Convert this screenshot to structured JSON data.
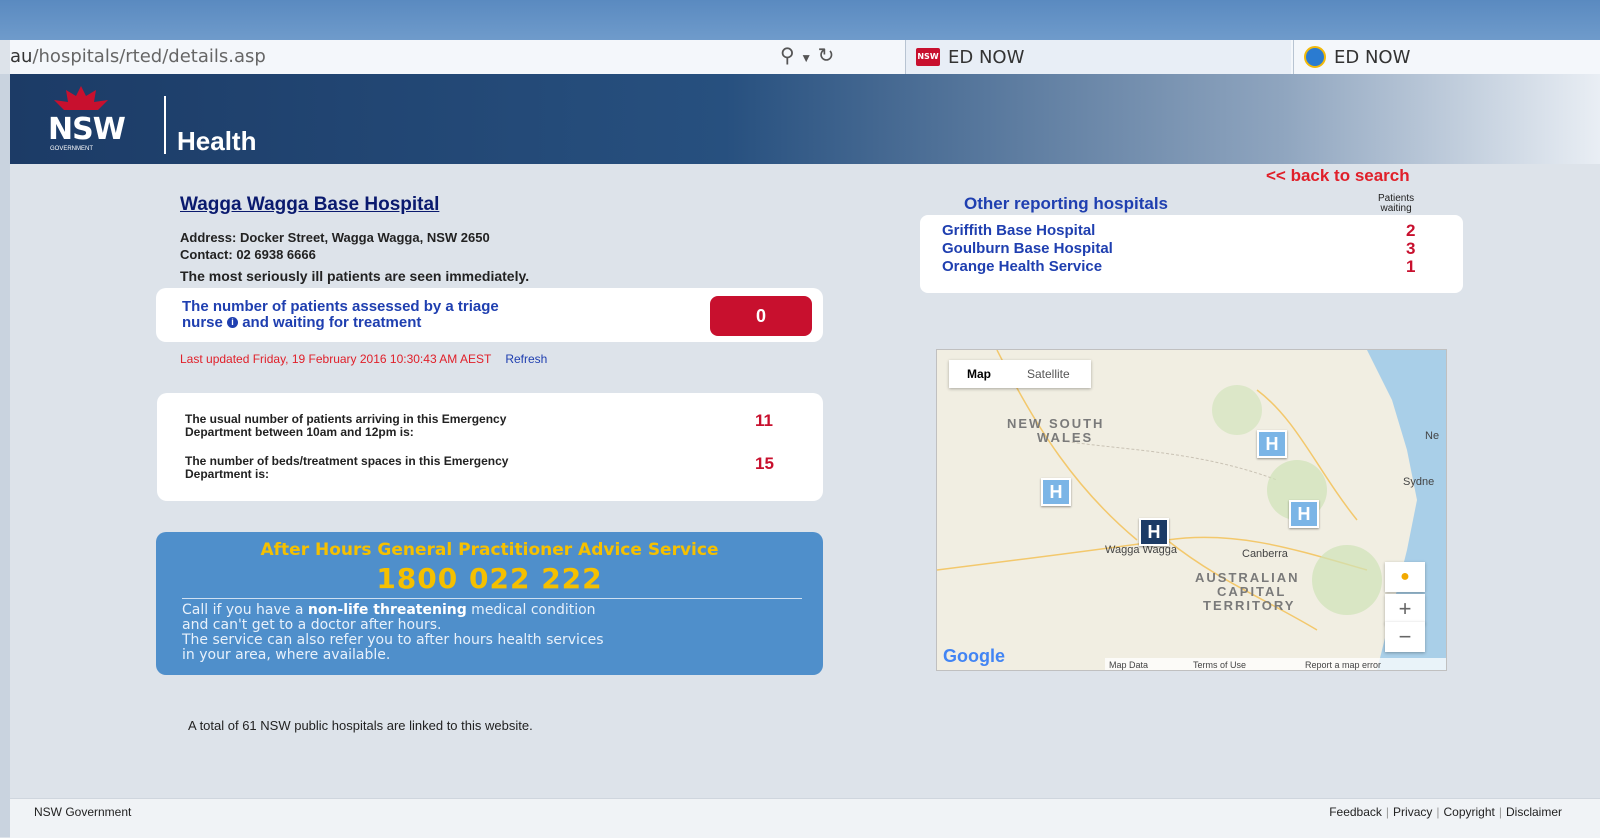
{
  "browser": {
    "address_host": "au",
    "address_path": "/hospitals/rted/details.asp",
    "search_icon": "search-icon",
    "refresh_icon": "refresh-icon",
    "tabs": [
      {
        "label": "ED NOW",
        "icon": "nsw-favicon-icon"
      },
      {
        "label": "ED NOW",
        "icon": "ie-icon"
      }
    ]
  },
  "header": {
    "logo_text": "NSW",
    "logo_sub": "GOVERNMENT",
    "title": "Health"
  },
  "nav": {
    "back_to_search": "<< back to search"
  },
  "hospital": {
    "name": "Wagga Wagga Base Hospital",
    "address": "Address: Docker Street, Wagga Wagga, NSW 2650",
    "contact": "Contact: 02 6938 6666",
    "seen_note": "The most seriously ill patients are seen immediately.",
    "triage_label_1": "The number of patients assessed by a triage",
    "triage_label_2": "nurse",
    "triage_label_3": "and waiting for treatment",
    "triage_count": "0",
    "last_updated": "Last updated Friday, 19 February 2016 10:30:43 AM AEST",
    "refresh_label": "Refresh"
  },
  "stats": [
    {
      "label_1": "The usual number of patients arriving in this Emergency",
      "label_2": "Department between 10am and 12pm is:",
      "value": "11"
    },
    {
      "label_1": "The number of beds/treatment spaces in this Emergency",
      "label_2": "Department is:",
      "value": "15"
    }
  ],
  "after_hours": {
    "title": "After Hours General Practitioner Advice Service",
    "phone": "1800 022 222",
    "line1_pre": "Call if you have a ",
    "line1_bold": "non-life threatening",
    "line1_post": " medical condition",
    "line2": "and can't get to a doctor after hours.",
    "line3": "The service can also refer you to after hours health services",
    "line4": "in your area, where available."
  },
  "total_note": "A total of 61 NSW public hospitals are linked to this website.",
  "other_hospitals": {
    "title": "Other reporting hospitals",
    "col_header_1": "Patients",
    "col_header_2": "waiting",
    "items": [
      {
        "name": "Griffith Base Hospital",
        "waiting": "2"
      },
      {
        "name": "Goulburn Base Hospital",
        "waiting": "3"
      },
      {
        "name": "Orange Health Service",
        "waiting": "1"
      }
    ]
  },
  "map": {
    "type_map": "Map",
    "type_satellite": "Satellite",
    "region_1": "NEW SOUTH",
    "region_2": "WALES",
    "act_1": "AUSTRALIAN",
    "act_2": "CAPITAL",
    "act_3": "TERRITORY",
    "city_wagga": "Wagga Wagga",
    "city_canberra": "Canberra",
    "city_sydney": "Sydne",
    "city_ne": "Ne",
    "zoom_in": "+",
    "zoom_out": "−",
    "google": "Google",
    "footer_data": "Map Data",
    "footer_terms": "Terms of Use",
    "footer_report": "Report a map error"
  },
  "footer": {
    "left": "NSW Government",
    "links": [
      "Feedback",
      "Privacy",
      "Copyright",
      "Disclaimer"
    ]
  },
  "colors": {
    "accent_red": "#c8102e",
    "link_blue": "#1f3fb0",
    "banner_blue": "#4f8fcb",
    "phone_yellow": "#f5c000"
  }
}
